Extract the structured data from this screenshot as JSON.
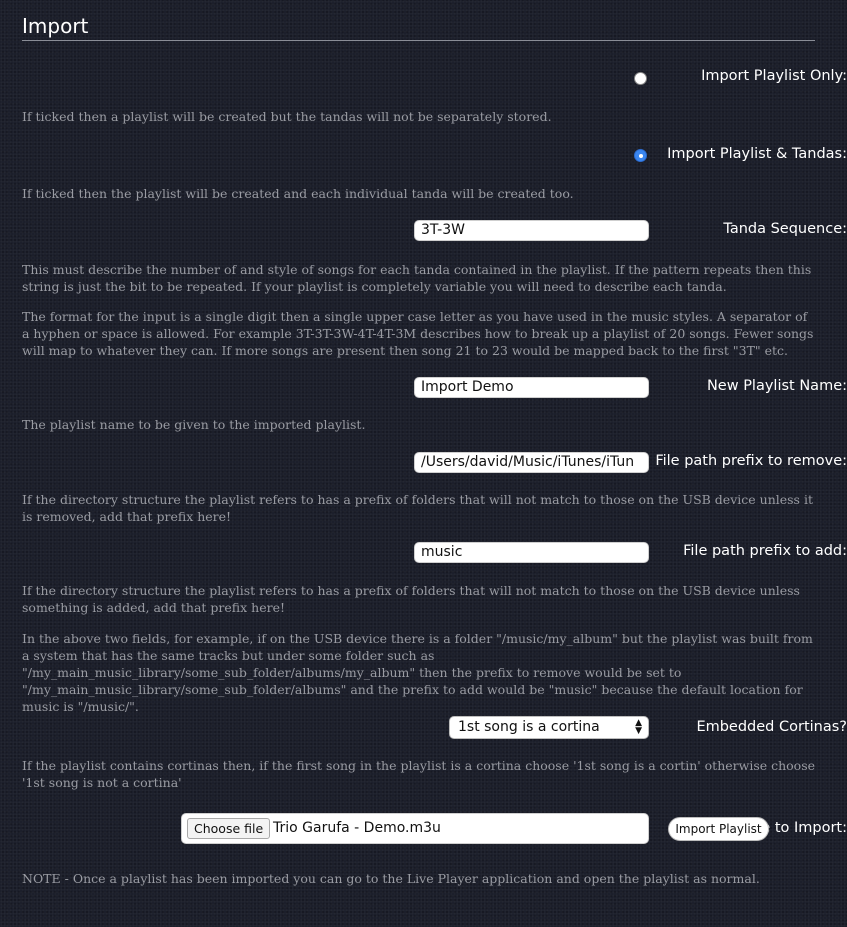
{
  "section_title": "Import",
  "import_only": {
    "label": "Import Playlist Only:",
    "checked": false,
    "help": "If ticked then a playlist will be created but the tandas will not be separately stored."
  },
  "import_tandas": {
    "label": "Import Playlist & Tandas:",
    "checked": true,
    "help": "If ticked then the playlist will be created and each individual tanda will be created too."
  },
  "tanda_sequence": {
    "label": "Tanda Sequence:",
    "value": "3T-3W",
    "help1": "This must describe the number of and style of songs for each tanda contained in the playlist. If the pattern repeats then this string is just the bit to be repeated. If your playlist is completely variable you will need to describe each tanda.",
    "help2": "The format for the input is a single digit then a single upper case letter as you have used in the music styles. A separator of a hyphen or space is allowed. For example 3T-3T-3W-4T-4T-3M describes how to break up a playlist of 20 songs. Fewer songs will map to whatever they can. If more songs are present then song 21 to 23 would be mapped back to the first \"3T\" etc."
  },
  "playlist_name": {
    "label": "New Playlist Name:",
    "value": "Import Demo",
    "help": "The playlist name to be given to the imported playlist."
  },
  "prefix_remove": {
    "label": "File path prefix to remove:",
    "value": "/Users/david/Music/iTunes/iTun",
    "help": "If the directory structure the playlist refers to has a prefix of folders that will not match to those on the USB device unless it is removed, add that prefix here!"
  },
  "prefix_add": {
    "label": "File path prefix to add:",
    "value": "music",
    "help1": "If the directory structure the playlist refers to has a prefix of folders that will not match to those on the USB device unless something is added, add that prefix here!",
    "help2": "In the above two fields, for example, if on the USB device there is a folder \"/music/my_album\" but the playlist was built from a system that has the same tracks but under some folder such as \"/my_main_music_library/some_sub_folder/albums/my_album\" then the prefix to remove would be set to \"/my_main_music_library/some_sub_folder/albums\" and the prefix to add would be \"music\" because the default location for music is \"/music/\"."
  },
  "cortinas": {
    "label": "Embedded Cortinas?",
    "selected": "1st song is a cortina",
    "help": "If the playlist contains cortinas then, if the first song in the playlist is a cortina choose '1st song is a cortin' otherwise choose '1st song is not a cortina'"
  },
  "file_import": {
    "label": "File to Import:",
    "choose_label": "Choose file",
    "file_name": "Trio Garufa - Demo.m3u",
    "import_button": "Import Playlist"
  },
  "note": "NOTE - Once a playlist has been imported you can go to the Live Player application and open the playlist as normal."
}
